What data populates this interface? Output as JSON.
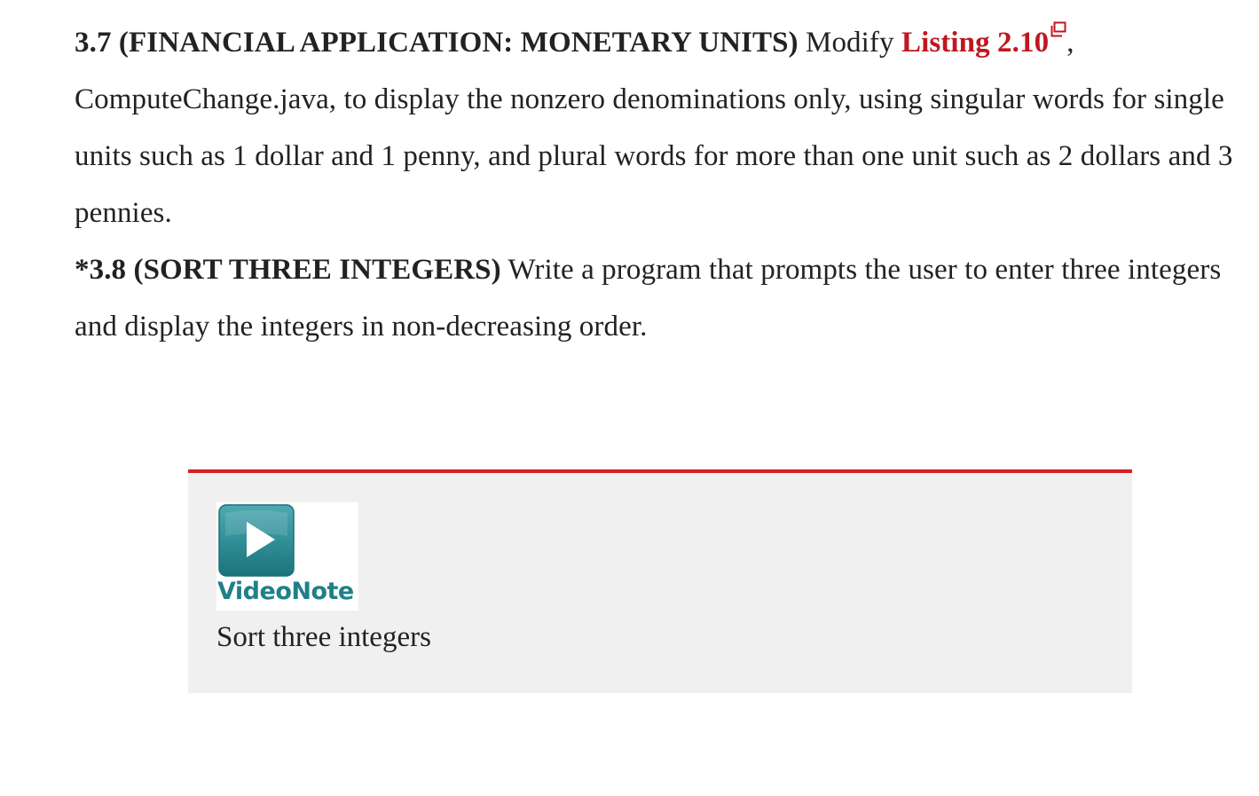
{
  "exercises": [
    {
      "head": "3.7 (FINANCIAL APPLICATION: MONETARY UNITS)",
      "before_link": " Modify ",
      "link_text": "Listing 2.10",
      "link_icon": "external-link-icon",
      "after_link": ", ComputeChange.java, to display the nonzero denominations only, using singular words for single units such as 1 dollar and 1 penny, and plural words for more than one unit such as 2 dollars and 3 pennies."
    },
    {
      "head": "*3.8 (SORT THREE INTEGERS)",
      "body": " Write a program that prompts the user to enter three integers and display the integers in non-decreasing order."
    }
  ],
  "videonote": {
    "icon": "play-icon",
    "label": "VideoNote",
    "caption": "Sort three integers"
  },
  "colors": {
    "link": "#c0171f",
    "box_border": "#d41f26",
    "box_background": "#f0f0f0",
    "videonote_teal": "#1f8088"
  }
}
